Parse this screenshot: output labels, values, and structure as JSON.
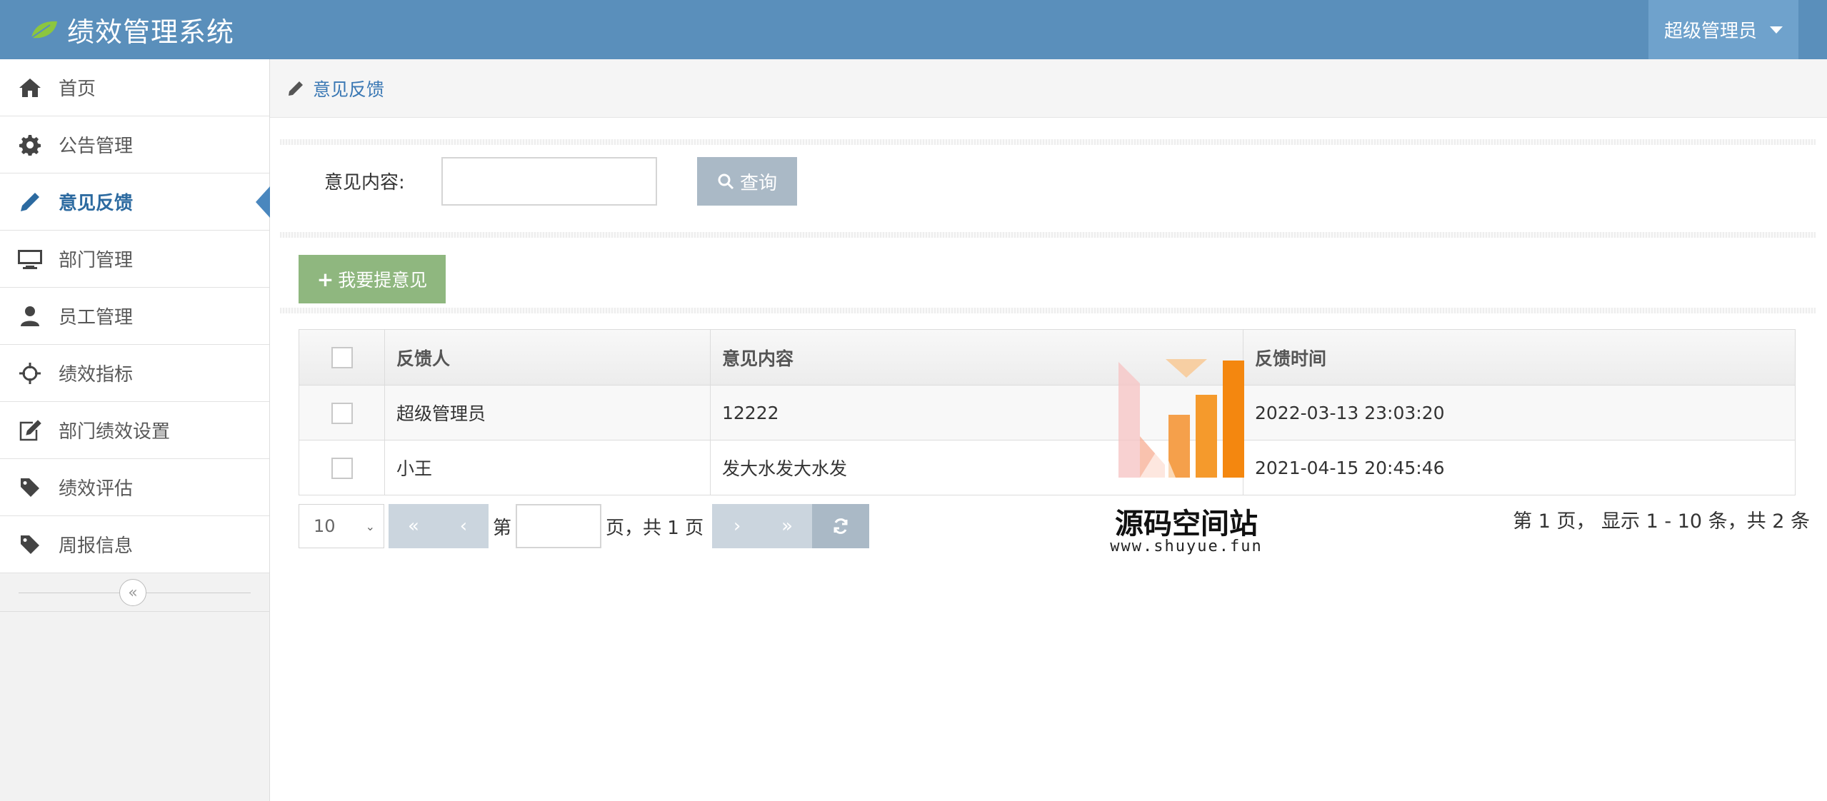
{
  "header": {
    "title": "绩效管理系统",
    "user_menu": "超级管理员"
  },
  "sidebar": {
    "items": [
      {
        "label": "首页",
        "icon": "home-icon"
      },
      {
        "label": "公告管理",
        "icon": "gear-icon"
      },
      {
        "label": "意见反馈",
        "icon": "pencil-icon",
        "active": true
      },
      {
        "label": "部门管理",
        "icon": "monitor-icon"
      },
      {
        "label": "员工管理",
        "icon": "user-icon"
      },
      {
        "label": "绩效指标",
        "icon": "crosshairs-icon"
      },
      {
        "label": "部门绩效设置",
        "icon": "edit-icon"
      },
      {
        "label": "绩效评估",
        "icon": "tag-icon"
      },
      {
        "label": "周报信息",
        "icon": "tag-icon"
      }
    ],
    "collapse_glyph": "«"
  },
  "breadcrumb": {
    "label": "意见反馈"
  },
  "search": {
    "label": "意见内容:",
    "value": "",
    "button": "查询"
  },
  "toolbar": {
    "add_label": "我要提意见"
  },
  "table": {
    "columns": [
      "反馈人",
      "意见内容",
      "反馈时间"
    ],
    "rows": [
      [
        "超级管理员",
        "12222",
        "2022-03-13 23:03:20"
      ],
      [
        "小王",
        "发大水发大水发",
        "2021-04-15 20:45:46"
      ]
    ]
  },
  "pager": {
    "page_size": "10",
    "first": "«",
    "prev": "‹",
    "next": "›",
    "last": "»",
    "prefix": "第",
    "suffix": "页，共 1 页",
    "info": "第 1 页， 显示 1 - 10 条，共 2 条"
  },
  "watermark": {
    "title": "源码空间站",
    "url": "www.shuyue.fun"
  },
  "colors": {
    "header_bg": "#5a8fbb",
    "active_nav": "#2c6aa0",
    "add_button": "#8fb77f",
    "search_button": "#aab9c6"
  }
}
